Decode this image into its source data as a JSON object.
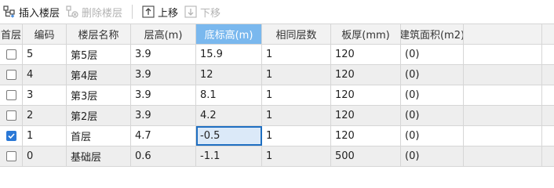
{
  "toolbar": {
    "insert_floor": "插入楼层",
    "delete_floor": "删除楼层",
    "move_up": "上移",
    "move_down": "下移"
  },
  "table": {
    "columns": [
      "首层",
      "编码",
      "楼层名称",
      "层高(m)",
      "底标高(m)",
      "相同层数",
      "板厚(mm)",
      "建筑面积(m2)"
    ],
    "sorted_column": "底标高(m)",
    "rows": [
      {
        "first": false,
        "code": "5",
        "name": "第5层",
        "height": "3.9",
        "base": "15.9",
        "same": "1",
        "thickness": "120",
        "area": "(0)"
      },
      {
        "first": false,
        "code": "4",
        "name": "第4层",
        "height": "3.9",
        "base": "12",
        "same": "1",
        "thickness": "120",
        "area": "(0)"
      },
      {
        "first": false,
        "code": "3",
        "name": "第3层",
        "height": "3.9",
        "base": "8.1",
        "same": "1",
        "thickness": "120",
        "area": "(0)"
      },
      {
        "first": false,
        "code": "2",
        "name": "第2层",
        "height": "3.9",
        "base": "4.2",
        "same": "1",
        "thickness": "120",
        "area": "(0)"
      },
      {
        "first": true,
        "code": "1",
        "name": "首层",
        "height": "4.7",
        "base": "-0.5",
        "same": "1",
        "thickness": "120",
        "area": "(0)"
      },
      {
        "first": false,
        "code": "0",
        "name": "基础层",
        "height": "0.6",
        "base": "-1.1",
        "same": "1",
        "thickness": "500",
        "area": "(0)"
      }
    ]
  },
  "colors": {
    "sorted_header": "#7ab8ee",
    "selection_border": "#1f6fc2",
    "checkbox_on": "#2a78d6"
  }
}
